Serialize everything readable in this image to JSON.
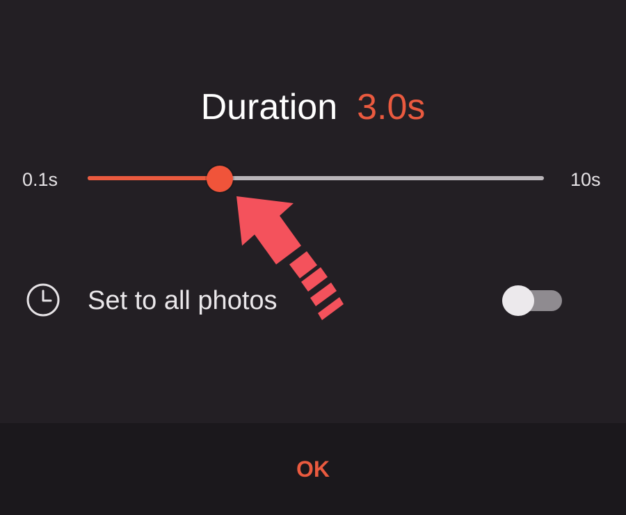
{
  "dialog": {
    "title": "Duration",
    "value_text": "3.0s"
  },
  "slider": {
    "min_label": "0.1s",
    "max_label": "10s",
    "fraction": 0.29
  },
  "set_all": {
    "label": "Set to all photos",
    "icon": "clock-icon",
    "enabled": false
  },
  "footer": {
    "ok_label": "OK"
  },
  "colors": {
    "accent": "#ea5a3f",
    "background": "#231f24",
    "footer_background": "#1b181c",
    "annotation_arrow": "#f4525c"
  }
}
